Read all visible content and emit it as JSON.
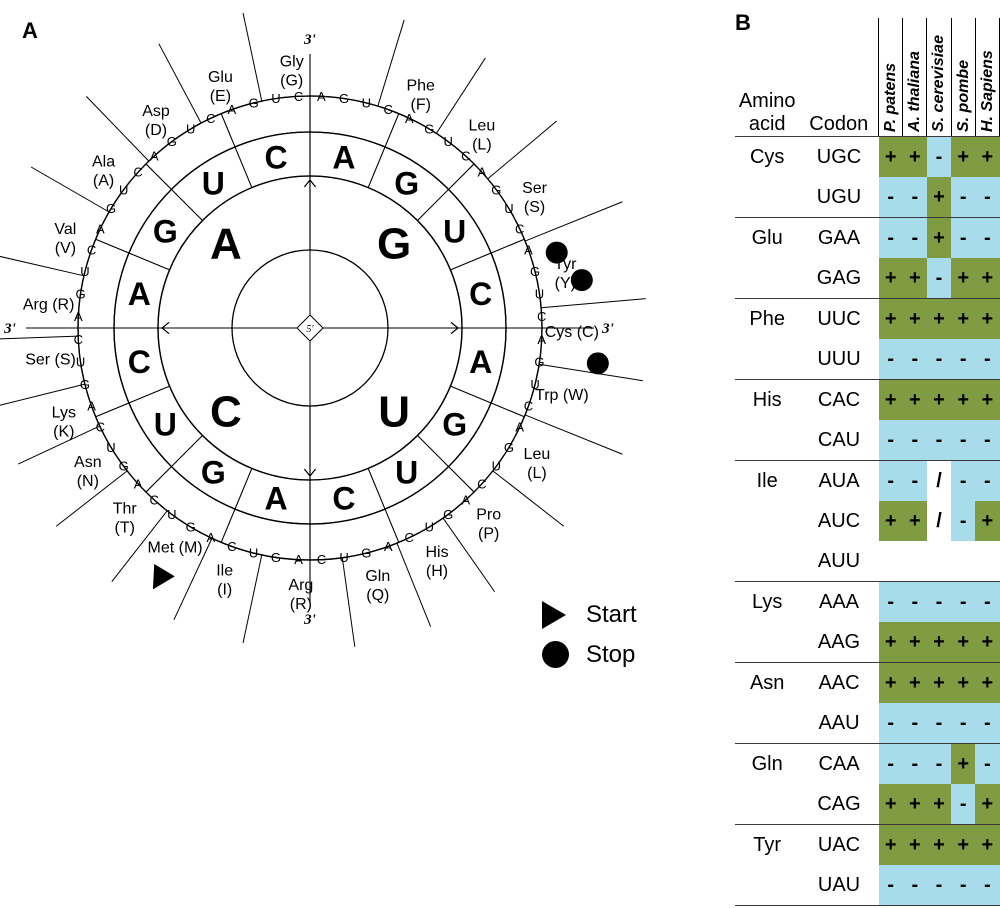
{
  "panels": {
    "a_letter": "A",
    "b_letter": "B"
  },
  "wheel": {
    "center_marker": "5'",
    "prime_top": "3'",
    "prime_left": "3'",
    "prime_right": "3'",
    "prime_bottom": "3'",
    "ring1": [
      "G",
      "U",
      "C",
      "A"
    ],
    "ring2": [
      "A",
      "G",
      "U",
      "C",
      "A",
      "G",
      "U",
      "C",
      "A",
      "G",
      "U",
      "C",
      "A",
      "G",
      "U",
      "C"
    ],
    "ring3": [
      "A",
      "G",
      "U",
      "C",
      "A",
      "G",
      "U",
      "C",
      "A",
      "G",
      "U",
      "C",
      "A",
      "G",
      "U",
      "C",
      "A",
      "G",
      "U",
      "C",
      "A",
      "G",
      "U",
      "C",
      "A",
      "G",
      "U",
      "C",
      "A",
      "G",
      "U",
      "C",
      "A",
      "G",
      "U",
      "C",
      "A",
      "G",
      "U",
      "C",
      "A",
      "G",
      "U",
      "C",
      "A",
      "G",
      "U",
      "C",
      "A",
      "G",
      "U",
      "C",
      "A",
      "G",
      "U",
      "C",
      "A",
      "G",
      "U",
      "C",
      "A",
      "G",
      "U",
      "C"
    ],
    "amino_acids": [
      {
        "name": "Gly",
        "code": "(G)"
      },
      {
        "name": "Phe",
        "code": "(F)"
      },
      {
        "name": "Leu",
        "code": "(L)"
      },
      {
        "name": "Ser",
        "code": "(S)"
      },
      {
        "name": "Tyr",
        "code": "(Y)"
      },
      {
        "name": "Cys (C)",
        "code": ""
      },
      {
        "name": "Trp (W)",
        "code": ""
      },
      {
        "name": "Leu",
        "code": "(L)"
      },
      {
        "name": "Pro",
        "code": "(P)"
      },
      {
        "name": "His",
        "code": "(H)"
      },
      {
        "name": "Gln",
        "code": "(Q)"
      },
      {
        "name": "Arg",
        "code": "(R)"
      },
      {
        "name": "Ile",
        "code": "(I)"
      },
      {
        "name": "Met (M)",
        "code": ""
      },
      {
        "name": "Thr",
        "code": "(T)"
      },
      {
        "name": "Asn",
        "code": "(N)"
      },
      {
        "name": "Lys",
        "code": "(K)"
      },
      {
        "name": "Ser (S)",
        "code": ""
      },
      {
        "name": "Arg (R)",
        "code": ""
      },
      {
        "name": "Val",
        "code": "(V)"
      },
      {
        "name": "Ala",
        "code": "(A)"
      },
      {
        "name": "Asp",
        "code": "(D)"
      },
      {
        "name": "Glu",
        "code": "(E)"
      }
    ],
    "legend": [
      {
        "symbol": "start-triangle",
        "label": "Start"
      },
      {
        "symbol": "stop-circle",
        "label": "Stop"
      }
    ]
  },
  "colors": {
    "green": "#7f9c42",
    "blue": "#a9dcea",
    "line": "#3a3a3a"
  },
  "table": {
    "header": {
      "amino_acid_line1": "Amino",
      "amino_acid_line2": "acid",
      "codon": "Codon",
      "species": [
        "P. patens",
        "A. thaliana",
        "S. cerevisiae",
        "S. pombe",
        "H. Sapiens"
      ]
    },
    "rows": [
      {
        "aa": "Cys",
        "codon": "UGC",
        "group_start": true,
        "cells": [
          {
            "v": "+",
            "c": "g"
          },
          {
            "v": "+",
            "c": "g"
          },
          {
            "v": "-",
            "c": "b"
          },
          {
            "v": "+",
            "c": "g"
          },
          {
            "v": "+",
            "c": "g"
          }
        ]
      },
      {
        "aa": "",
        "codon": "UGU",
        "group_start": false,
        "cells": [
          {
            "v": "-",
            "c": "b"
          },
          {
            "v": "-",
            "c": "b"
          },
          {
            "v": "+",
            "c": "g"
          },
          {
            "v": "-",
            "c": "b"
          },
          {
            "v": "-",
            "c": "b"
          }
        ]
      },
      {
        "aa": "Glu",
        "codon": "GAA",
        "group_start": true,
        "cells": [
          {
            "v": "-",
            "c": "b"
          },
          {
            "v": "-",
            "c": "b"
          },
          {
            "v": "+",
            "c": "g"
          },
          {
            "v": "-",
            "c": "b"
          },
          {
            "v": "-",
            "c": "b"
          }
        ]
      },
      {
        "aa": "",
        "codon": "GAG",
        "group_start": false,
        "cells": [
          {
            "v": "+",
            "c": "g"
          },
          {
            "v": "+",
            "c": "g"
          },
          {
            "v": "-",
            "c": "b"
          },
          {
            "v": "+",
            "c": "g"
          },
          {
            "v": "+",
            "c": "g"
          }
        ]
      },
      {
        "aa": "Phe",
        "codon": "UUC",
        "group_start": true,
        "cells": [
          {
            "v": "+",
            "c": "g"
          },
          {
            "v": "+",
            "c": "g"
          },
          {
            "v": "+",
            "c": "g"
          },
          {
            "v": "+",
            "c": "g"
          },
          {
            "v": "+",
            "c": "g"
          }
        ]
      },
      {
        "aa": "",
        "codon": "UUU",
        "group_start": false,
        "cells": [
          {
            "v": "-",
            "c": "b"
          },
          {
            "v": "-",
            "c": "b"
          },
          {
            "v": "-",
            "c": "b"
          },
          {
            "v": "-",
            "c": "b"
          },
          {
            "v": "-",
            "c": "b"
          }
        ]
      },
      {
        "aa": "His",
        "codon": "CAC",
        "group_start": true,
        "cells": [
          {
            "v": "+",
            "c": "g"
          },
          {
            "v": "+",
            "c": "g"
          },
          {
            "v": "+",
            "c": "g"
          },
          {
            "v": "+",
            "c": "g"
          },
          {
            "v": "+",
            "c": "g"
          }
        ]
      },
      {
        "aa": "",
        "codon": "CAU",
        "group_start": false,
        "cells": [
          {
            "v": "-",
            "c": "b"
          },
          {
            "v": "-",
            "c": "b"
          },
          {
            "v": "-",
            "c": "b"
          },
          {
            "v": "-",
            "c": "b"
          },
          {
            "v": "-",
            "c": "b"
          }
        ]
      },
      {
        "aa": "Ile",
        "codon": "AUA",
        "group_start": true,
        "cells": [
          {
            "v": "-",
            "c": "b"
          },
          {
            "v": "-",
            "c": "b"
          },
          {
            "v": "/",
            "c": "n"
          },
          {
            "v": "-",
            "c": "b"
          },
          {
            "v": "-",
            "c": "b"
          }
        ]
      },
      {
        "aa": "",
        "codon": "AUC",
        "group_start": false,
        "cells": [
          {
            "v": "+",
            "c": "g"
          },
          {
            "v": "+",
            "c": "g"
          },
          {
            "v": "/",
            "c": "n"
          },
          {
            "v": "-",
            "c": "b"
          },
          {
            "v": "+",
            "c": "g"
          }
        ]
      },
      {
        "aa": "",
        "codon": "AUU",
        "group_start": false,
        "cells": [
          {
            "v": "",
            "c": "n"
          },
          {
            "v": "",
            "c": "n"
          },
          {
            "v": "",
            "c": "n"
          },
          {
            "v": "",
            "c": "n"
          },
          {
            "v": "",
            "c": "n"
          }
        ]
      },
      {
        "aa": "Lys",
        "codon": "AAA",
        "group_start": true,
        "cells": [
          {
            "v": "-",
            "c": "b"
          },
          {
            "v": "-",
            "c": "b"
          },
          {
            "v": "-",
            "c": "b"
          },
          {
            "v": "-",
            "c": "b"
          },
          {
            "v": "-",
            "c": "b"
          }
        ]
      },
      {
        "aa": "",
        "codon": "AAG",
        "group_start": false,
        "cells": [
          {
            "v": "+",
            "c": "g"
          },
          {
            "v": "+",
            "c": "g"
          },
          {
            "v": "+",
            "c": "g"
          },
          {
            "v": "+",
            "c": "g"
          },
          {
            "v": "+",
            "c": "g"
          }
        ]
      },
      {
        "aa": "Asn",
        "codon": "AAC",
        "group_start": true,
        "cells": [
          {
            "v": "+",
            "c": "g"
          },
          {
            "v": "+",
            "c": "g"
          },
          {
            "v": "+",
            "c": "g"
          },
          {
            "v": "+",
            "c": "g"
          },
          {
            "v": "+",
            "c": "g"
          }
        ]
      },
      {
        "aa": "",
        "codon": "AAU",
        "group_start": false,
        "cells": [
          {
            "v": "-",
            "c": "b"
          },
          {
            "v": "-",
            "c": "b"
          },
          {
            "v": "-",
            "c": "b"
          },
          {
            "v": "-",
            "c": "b"
          },
          {
            "v": "-",
            "c": "b"
          }
        ]
      },
      {
        "aa": "Gln",
        "codon": "CAA",
        "group_start": true,
        "cells": [
          {
            "v": "-",
            "c": "b"
          },
          {
            "v": "-",
            "c": "b"
          },
          {
            "v": "-",
            "c": "b"
          },
          {
            "v": "+",
            "c": "g"
          },
          {
            "v": "-",
            "c": "b"
          }
        ]
      },
      {
        "aa": "",
        "codon": "CAG",
        "group_start": false,
        "cells": [
          {
            "v": "+",
            "c": "g"
          },
          {
            "v": "+",
            "c": "g"
          },
          {
            "v": "+",
            "c": "g"
          },
          {
            "v": "-",
            "c": "b"
          },
          {
            "v": "+",
            "c": "g"
          }
        ]
      },
      {
        "aa": "Tyr",
        "codon": "UAC",
        "group_start": true,
        "cells": [
          {
            "v": "+",
            "c": "g"
          },
          {
            "v": "+",
            "c": "g"
          },
          {
            "v": "+",
            "c": "g"
          },
          {
            "v": "+",
            "c": "g"
          },
          {
            "v": "+",
            "c": "g"
          }
        ]
      },
      {
        "aa": "",
        "codon": "UAU",
        "group_start": false,
        "cells": [
          {
            "v": "-",
            "c": "b"
          },
          {
            "v": "-",
            "c": "b"
          },
          {
            "v": "-",
            "c": "b"
          },
          {
            "v": "-",
            "c": "b"
          },
          {
            "v": "-",
            "c": "b"
          }
        ]
      }
    ]
  }
}
